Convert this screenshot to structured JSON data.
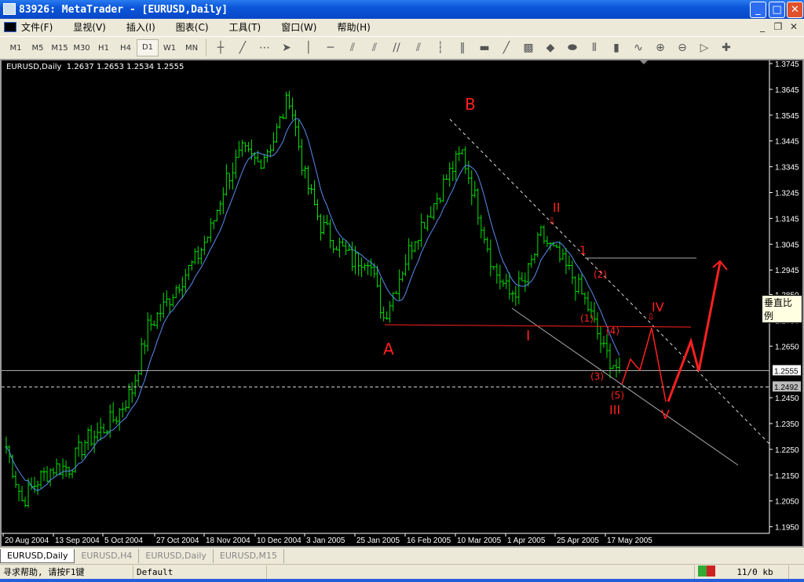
{
  "window": {
    "title": "83926: MetaTrader - [EURUSD,Daily]",
    "minimize": "_",
    "maximize": "□",
    "close": "✕"
  },
  "menu": [
    "文件(F)",
    "显视(V)",
    "插入(I)",
    "图表(C)",
    "工具(T)",
    "窗口(W)",
    "帮助(H)"
  ],
  "toolbar": {
    "timeframes": [
      "M1",
      "M5",
      "M15",
      "M30",
      "H1",
      "H4",
      "D1",
      "W1",
      "MN"
    ],
    "active_timeframe": "D1",
    "tools": [
      "crosshair-icon",
      "trendline-icon",
      "fibo-grid-icon",
      "cursor-icon",
      "vertical-line-icon",
      "horizontal-line-icon",
      "fan-icon",
      "fibo-fan-icon",
      "channel-icon",
      "fibo-channel-icon",
      "fibo-time-icon",
      "cycle-lines-icon",
      "rectangle-icon",
      "gann-line-icon",
      "gann-grid-icon",
      "arrows-icon",
      "ellipse-icon",
      "bar-chart-icon",
      "candle-chart-icon",
      "line-chart-icon",
      "zoom-in-icon",
      "zoom-out-icon",
      "auto-scroll-icon",
      "chart-shift-icon"
    ],
    "tool_glyphs": [
      "┼",
      "╱",
      "⋯",
      "➤",
      "│",
      "─",
      "⫽",
      "⫽",
      "//",
      "⫽",
      "┆",
      "‖",
      "▬",
      "╱",
      "▩",
      "◆",
      "⬬",
      "⫴",
      "▮",
      "∿",
      "⊕",
      "⊖",
      "▷",
      "✚"
    ]
  },
  "chart": {
    "header": {
      "symbol": "EURUSD,Daily",
      "open": "1.2637",
      "high": "1.2653",
      "low": "1.2534",
      "close": "1.2555"
    },
    "tooltip": "垂直比例",
    "bar_color": "#00e000",
    "ma_color": "#5a8cf0",
    "annotation_color": "#ff2020"
  },
  "chart_data": {
    "type": "bar",
    "symbol": "EURUSD",
    "timeframe": "Daily",
    "ylim": [
      1.195,
      1.3745
    ],
    "y_ticks": [
      "1.3745",
      "1.3645",
      "1.3545",
      "1.3445",
      "1.3345",
      "1.3245",
      "1.3145",
      "1.3045",
      "1.2945",
      "1.2850",
      "1.2750",
      "1.2650",
      "1.2450",
      "1.2350",
      "1.2250",
      "1.2150",
      "1.2050",
      "1.1950"
    ],
    "bid_label": "1.2555",
    "ask_label": "1.2492",
    "x_ticks": [
      "20 Aug 2004",
      "13 Sep 2004",
      "5 Oct 2004",
      "27 Oct 2004",
      "18 Nov 2004",
      "10 Dec 2004",
      "3 Jan 2005",
      "25 Jan 2005",
      "16 Feb 2005",
      "10 Mar 2005",
      "1 Apr 2005",
      "25 Apr 2005",
      "17 May 2005"
    ],
    "closes_every_5_bars": [
      1.226,
      1.205,
      1.213,
      1.218,
      1.218,
      1.228,
      1.232,
      1.238,
      1.248,
      1.272,
      1.28,
      1.29,
      1.298,
      1.31,
      1.33,
      1.34,
      1.336,
      1.345,
      1.362,
      1.33,
      1.312,
      1.305,
      1.298,
      1.3,
      1.276,
      1.292,
      1.308,
      1.318,
      1.33,
      1.34,
      1.318,
      1.295,
      1.285,
      1.29,
      1.308,
      1.3,
      1.292,
      1.28,
      1.263,
      1.2555
    ],
    "annotations": [
      "A",
      "B",
      "I",
      "II",
      "III",
      "IV",
      "V",
      "1",
      "(1)",
      "(2)",
      "(3)",
      "(4)",
      "(5)"
    ]
  },
  "tabs": [
    "EURUSD,Daily",
    "EURUSD,H4",
    "EURUSD,Daily",
    "EURUSD,M15"
  ],
  "status": {
    "help": "寻求帮助, 请按F1键",
    "profile": "Default",
    "traffic": "11/0 kb"
  }
}
